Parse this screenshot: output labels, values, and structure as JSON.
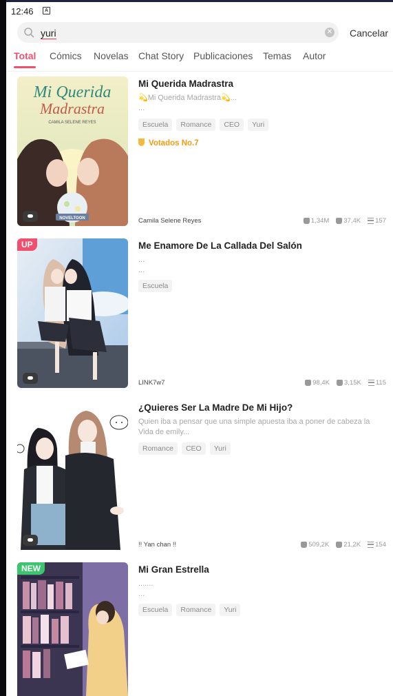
{
  "status": {
    "time": "12:46"
  },
  "search": {
    "query": "yuri",
    "cancel_label": "Cancelar"
  },
  "tabs": [
    {
      "label": "Total"
    },
    {
      "label": "Cómics"
    },
    {
      "label": "Novelas"
    },
    {
      "label": "Chat Story"
    },
    {
      "label": "Publicaciones"
    },
    {
      "label": "Temas"
    },
    {
      "label": "Autor"
    }
  ],
  "books": [
    {
      "cover_title_1": "Mi Querida",
      "cover_title_2": "Madrastra",
      "cover_author": "CAMILA SELENE REYES",
      "cover_brand": "NOVELTOON",
      "title": "Mi Querida Madrastra",
      "desc_1": "💫Mi Querida Madrastra💫...",
      "desc_2": "...",
      "tags": [
        "Escuela",
        "Romance",
        "CEO",
        "Yuri"
      ],
      "rank": "Votados No.7",
      "author": "Camila Selene Reyes",
      "likes": "1,34M",
      "votes": "37,4K",
      "chapters": "157"
    },
    {
      "badge": "UP",
      "title": "Me Enamore De La Callada Del Salón",
      "desc_1": "...",
      "desc_2": "...",
      "tags": [
        "Escuela"
      ],
      "author": "LINK7w7",
      "likes": "98,4K",
      "votes": "3,15K",
      "chapters": "115"
    },
    {
      "title": "¿Quieres Ser La Madre De Mi Hijo?",
      "desc_1": "Quien iba a pensar que una simple apuesta iba a poner de cabeza la Vida de emily...",
      "tags": [
        "Romance",
        "CEO",
        "Yuri"
      ],
      "author": "!! Yan chan !!",
      "likes": "509,2K",
      "votes": "21,2K",
      "chapters": "154"
    },
    {
      "badge": "NEW",
      "title": "Mi Gran Estrella",
      "desc_1": ".......",
      "desc_2": "...",
      "tags": [
        "Escuela",
        "Romance",
        "Yuri"
      ]
    }
  ]
}
